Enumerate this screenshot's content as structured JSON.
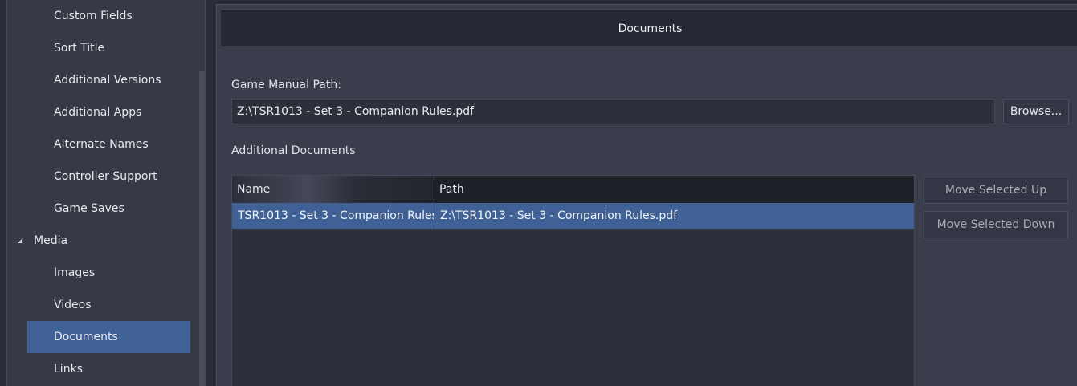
{
  "sidebar": {
    "items": [
      {
        "label": "Custom Fields"
      },
      {
        "label": "Sort Title"
      },
      {
        "label": "Additional Versions"
      },
      {
        "label": "Additional Apps"
      },
      {
        "label": "Alternate Names"
      },
      {
        "label": "Controller Support"
      },
      {
        "label": "Game Saves"
      },
      {
        "label": "Media",
        "group": true,
        "expanded": true,
        "icon": "expanded-triangle-icon"
      },
      {
        "label": "Images"
      },
      {
        "label": "Videos"
      },
      {
        "label": "Documents",
        "selected": true
      },
      {
        "label": "Links"
      }
    ]
  },
  "header": {
    "title": "Documents"
  },
  "manual": {
    "label": "Game Manual Path:",
    "value": "Z:\\TSR1013 - Set 3 - Companion Rules.pdf",
    "browse_label": "Browse..."
  },
  "additional": {
    "label": "Additional Documents",
    "columns": [
      "Name",
      "Path"
    ],
    "rows": [
      {
        "name": "TSR1013 - Set 3 - Companion Rules",
        "path": "Z:\\TSR1013 - Set 3 - Companion Rules.pdf",
        "selected": true
      }
    ],
    "move_up_label": "Move Selected Up",
    "move_down_label": "Move Selected Down"
  },
  "colors": {
    "selection": "#3f6196",
    "panel": "#3a3d4b",
    "header": "#262833",
    "sidebar": "#363946"
  }
}
